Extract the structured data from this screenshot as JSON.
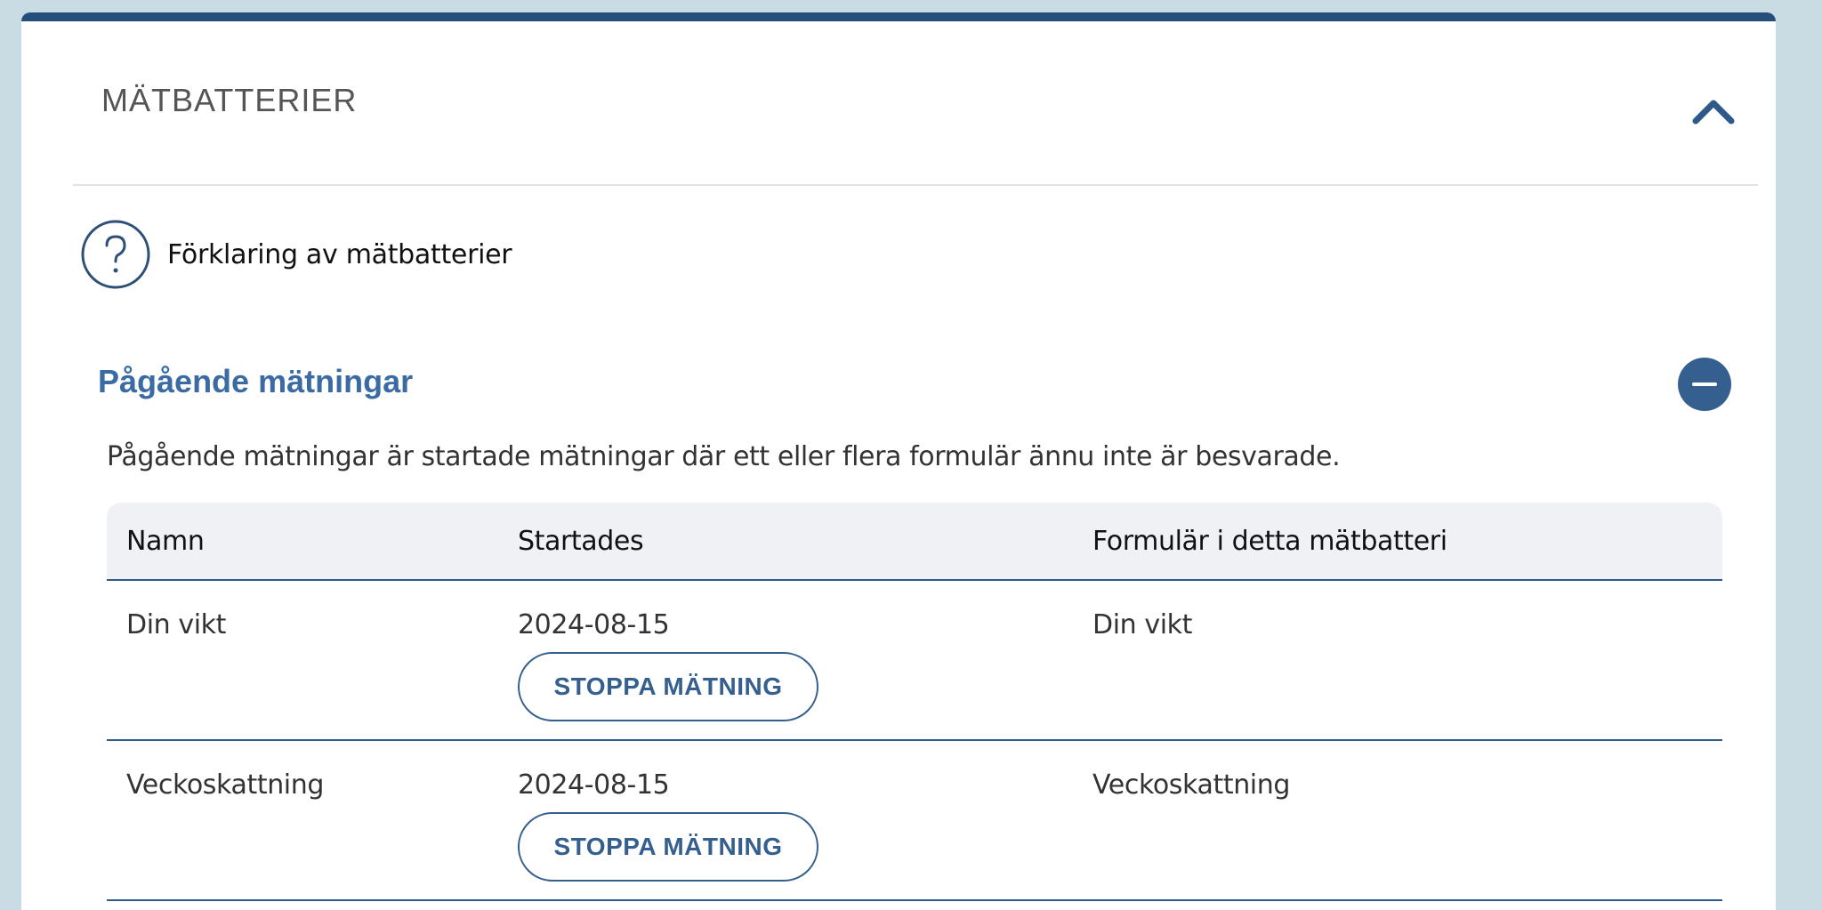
{
  "panel": {
    "title": "MÄTBATTERIER"
  },
  "help": {
    "label": "Förklaring av mätbatterier",
    "icon": "question-circle-icon"
  },
  "section": {
    "title": "Pågående mätningar",
    "description": "Pågående mätningar är startade mätningar där ett eller flera formulär ännu inte är besvarade."
  },
  "table": {
    "headers": [
      "Namn",
      "Startades",
      "Formulär i detta mätbatteri"
    ],
    "rows": [
      {
        "name": "Din vikt",
        "started": "2024-08-15",
        "forms": "Din vikt",
        "button": "STOPPA MÄTNING"
      },
      {
        "name": "Veckoskattning",
        "started": "2024-08-15",
        "forms": "Veckoskattning",
        "button": "STOPPA MÄTNING"
      }
    ]
  },
  "colors": {
    "accent": "#254f7a",
    "link_blue": "#3a6ca3",
    "button_blue": "#355f8e",
    "header_bg": "#f0f1f4"
  }
}
